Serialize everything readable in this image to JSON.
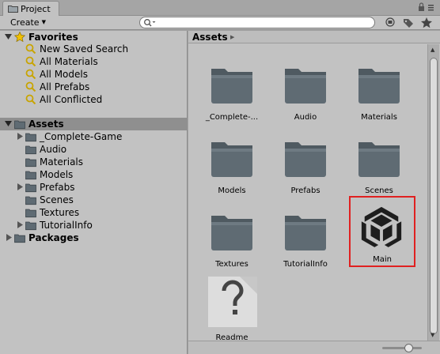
{
  "window": {
    "tab_title": "Project"
  },
  "toolbar": {
    "create_label": "Create",
    "search_value": "",
    "search_placeholder": ""
  },
  "tree": {
    "favorites_label": "Favorites",
    "favorites": [
      {
        "label": "New Saved Search"
      },
      {
        "label": "All Materials"
      },
      {
        "label": "All Models"
      },
      {
        "label": "All Prefabs"
      },
      {
        "label": "All Conflicted"
      }
    ],
    "assets_label": "Assets",
    "assets": [
      {
        "label": "_Complete-Game",
        "expandable": true
      },
      {
        "label": "Audio",
        "expandable": false
      },
      {
        "label": "Materials",
        "expandable": false
      },
      {
        "label": "Models",
        "expandable": false
      },
      {
        "label": "Prefabs",
        "expandable": true
      },
      {
        "label": "Scenes",
        "expandable": false
      },
      {
        "label": "Textures",
        "expandable": false
      },
      {
        "label": "TutorialInfo",
        "expandable": true
      }
    ],
    "packages_label": "Packages"
  },
  "content": {
    "breadcrumb": "Assets",
    "items": [
      {
        "name": "_Complete-...",
        "kind": "folder"
      },
      {
        "name": "Audio",
        "kind": "folder"
      },
      {
        "name": "Materials",
        "kind": "folder"
      },
      {
        "name": "Models",
        "kind": "folder"
      },
      {
        "name": "Prefabs",
        "kind": "folder"
      },
      {
        "name": "Scenes",
        "kind": "folder"
      },
      {
        "name": "Textures",
        "kind": "folder"
      },
      {
        "name": "TutorialInfo",
        "kind": "folder"
      },
      {
        "name": "Main",
        "kind": "unity-scene",
        "selected": true
      },
      {
        "name": "Readme",
        "kind": "readme"
      }
    ]
  },
  "colors": {
    "panel": "#c2c2c2",
    "selection_row": "#8f8f8f",
    "highlight_box": "#e02020",
    "folder": "#5f6b73",
    "favorite_star": "#f0c000"
  }
}
